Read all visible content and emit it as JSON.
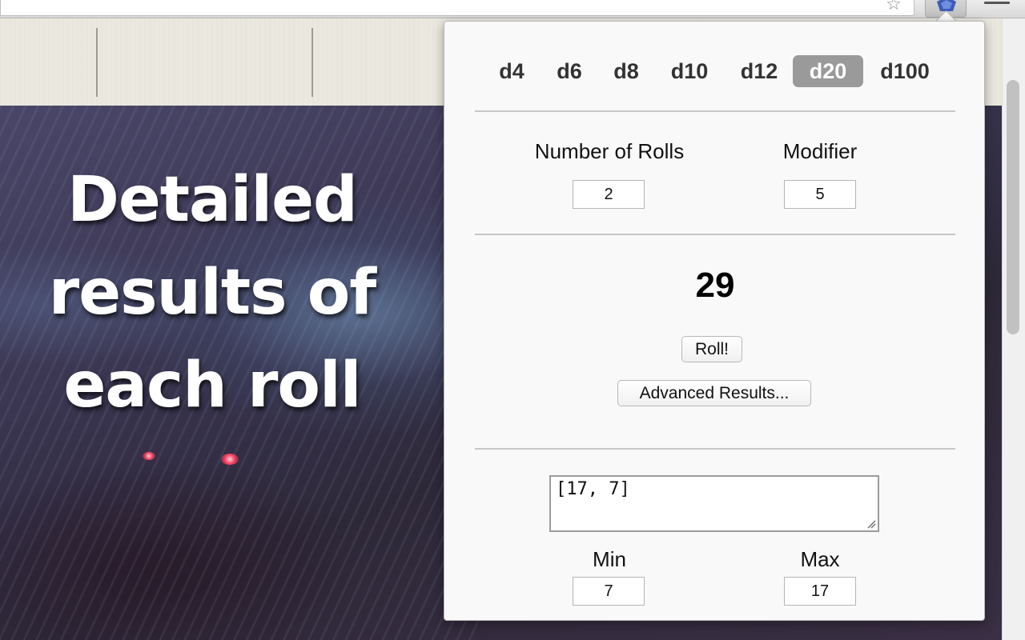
{
  "page": {
    "hero_title": "Detailed results of each roll"
  },
  "popup": {
    "dice": [
      {
        "label": "d4",
        "active": false
      },
      {
        "label": "d6",
        "active": false
      },
      {
        "label": "d8",
        "active": false
      },
      {
        "label": "d10",
        "active": false
      },
      {
        "label": "d12",
        "active": false
      },
      {
        "label": "d20",
        "active": true
      },
      {
        "label": "d100",
        "active": false
      }
    ],
    "number_of_rolls": {
      "label": "Number of Rolls",
      "value": "2"
    },
    "modifier": {
      "label": "Modifier",
      "value": "5"
    },
    "total": "29",
    "roll_button": "Roll!",
    "advanced_button": "Advanced Results...",
    "results": "[17, 7]",
    "min": {
      "label": "Min",
      "value": "7"
    },
    "max": {
      "label": "Max",
      "value": "17"
    }
  },
  "colors": {
    "active_die_bg": "#9a9a9a",
    "popup_bg": "#f9f9f9",
    "header_bg": "#ebe9df"
  },
  "icons": [
    "bookmark-star-icon",
    "dice-extension-icon",
    "chrome-menu-icon",
    "resize-grip-icon"
  ]
}
